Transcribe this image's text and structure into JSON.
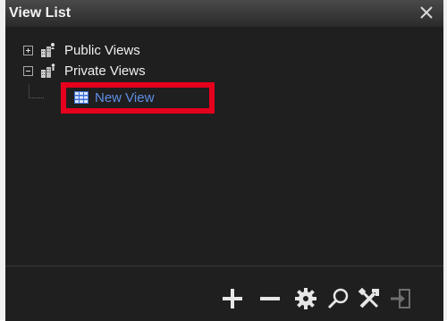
{
  "window": {
    "title": "View List",
    "close_icon": "close-icon"
  },
  "tree": {
    "nodes": [
      {
        "label": "Public Views",
        "expander": "plus",
        "icon": "shared-views-folder-icon"
      },
      {
        "label": "Private Views",
        "expander": "minus",
        "icon": "private-views-folder-icon",
        "children": [
          {
            "label": "New View",
            "icon": "grid-view-icon",
            "selected": true
          }
        ]
      }
    ]
  },
  "toolbar": {
    "buttons": [
      {
        "icon": "add-icon"
      },
      {
        "icon": "remove-icon"
      },
      {
        "icon": "settings-icon"
      },
      {
        "icon": "search-icon"
      },
      {
        "icon": "tools-icon"
      },
      {
        "icon": "export-icon",
        "disabled": true
      }
    ]
  },
  "colors": {
    "panel_bg": "#1f1f1f",
    "text": "#f0f0f0",
    "selected_text": "#5f8fe6",
    "highlight": "#e5001d"
  }
}
